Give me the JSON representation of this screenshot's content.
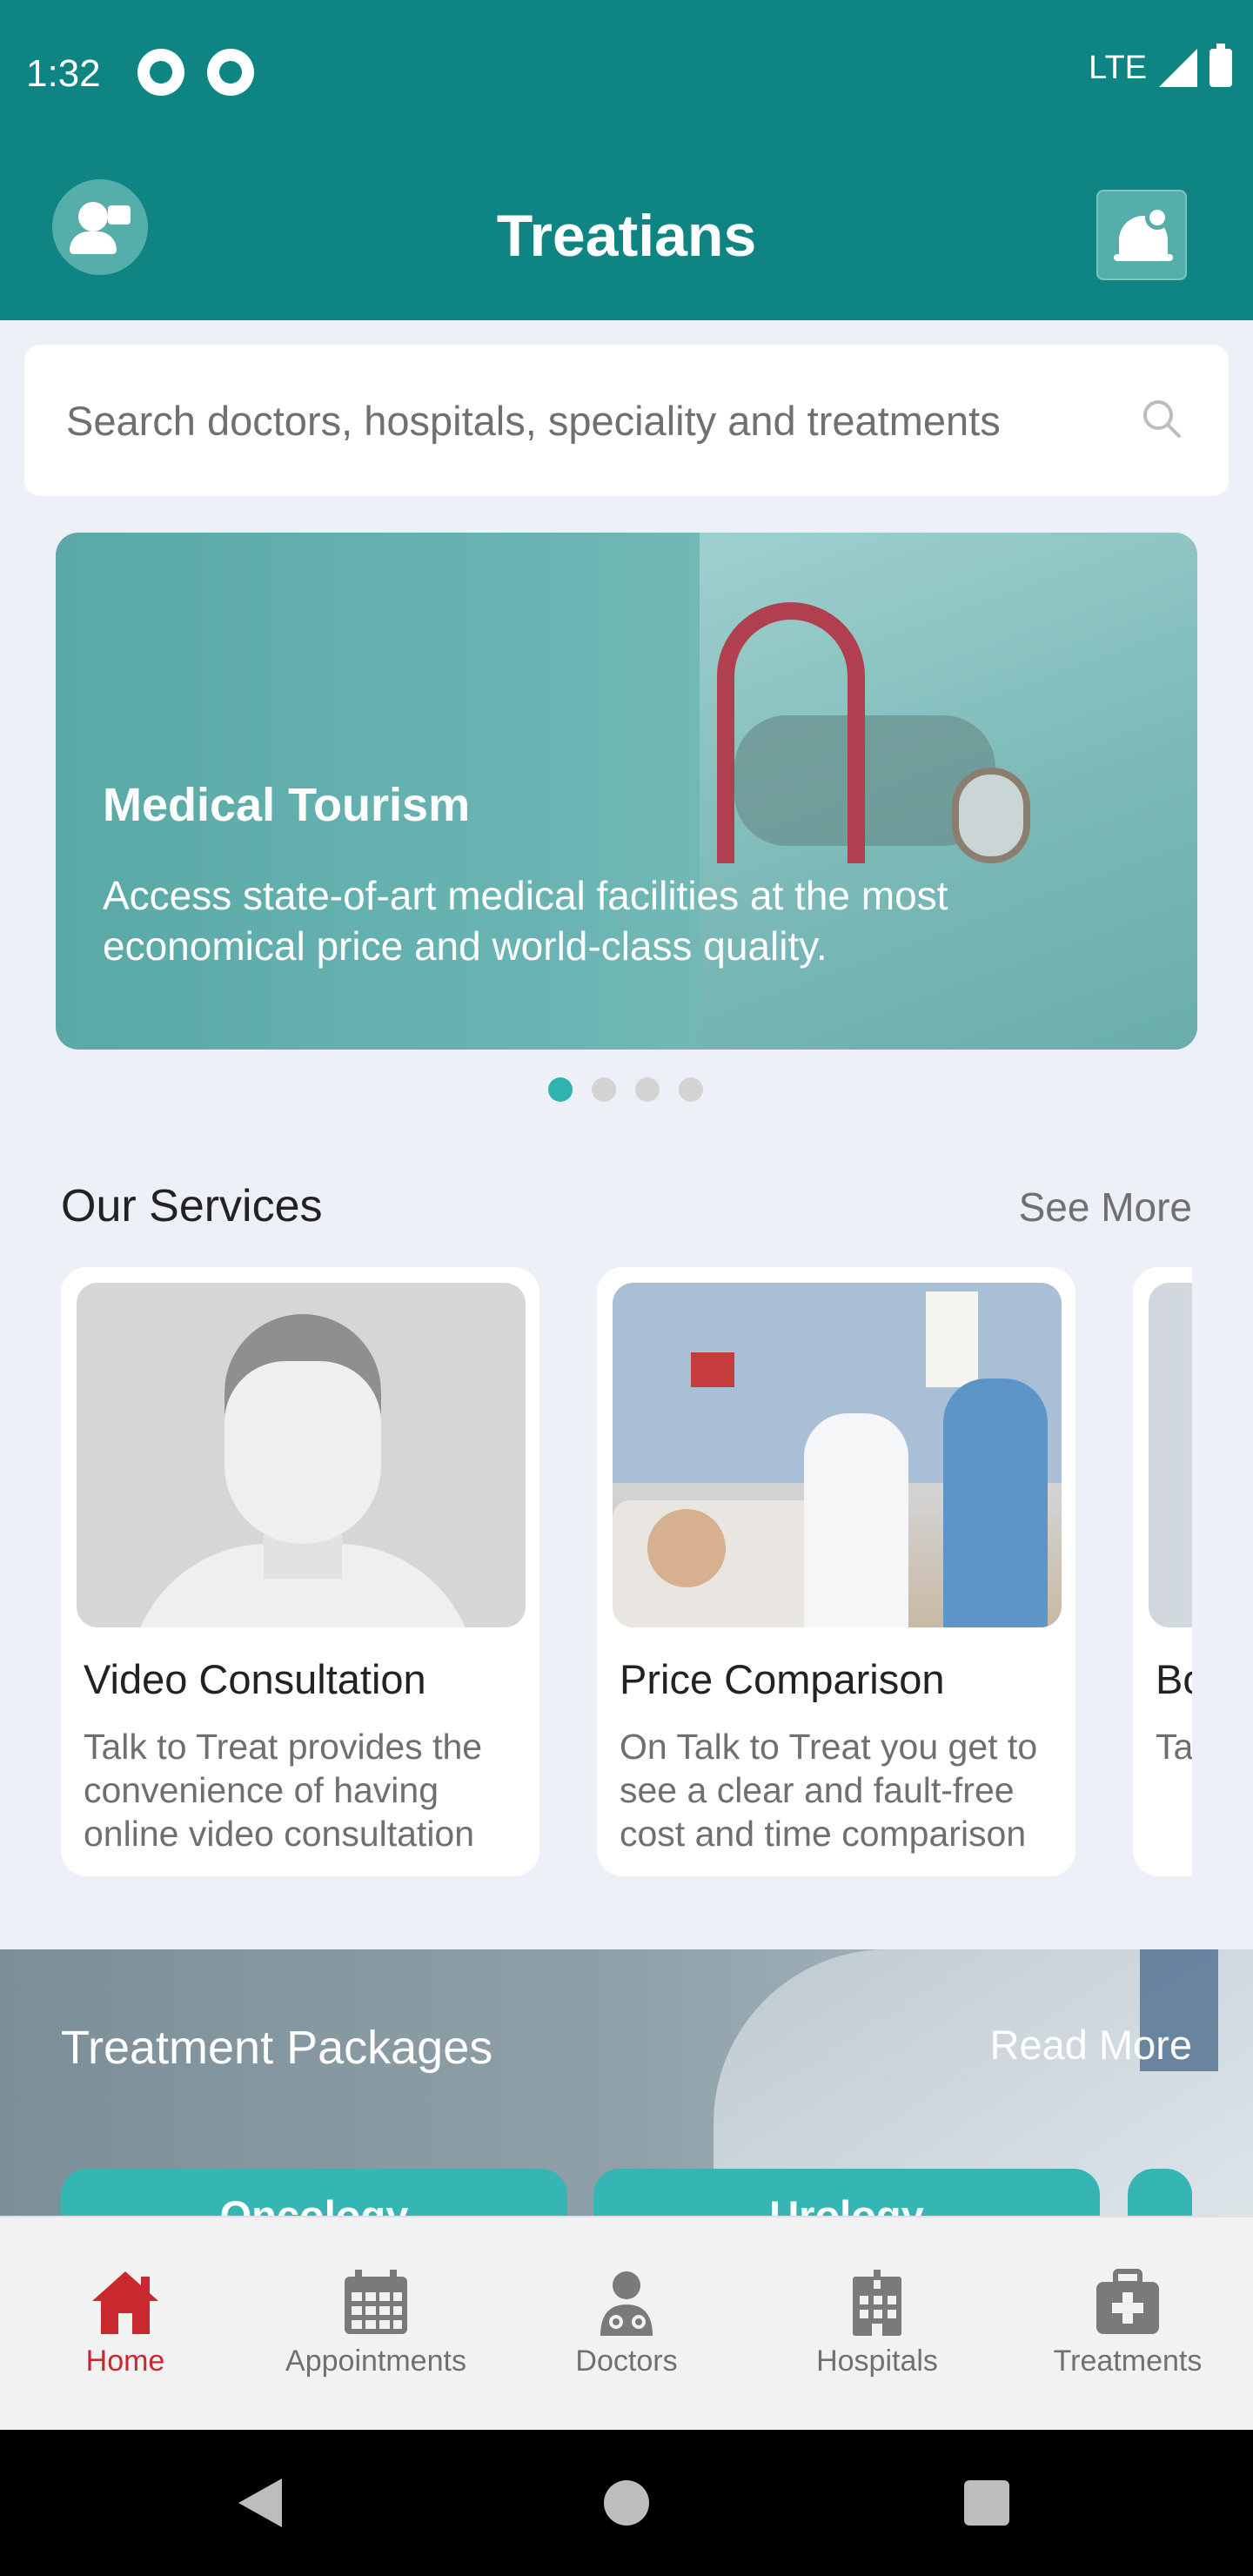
{
  "status_bar": {
    "time": "1:32",
    "network": "LTE"
  },
  "app_bar": {
    "title": "Treatians"
  },
  "search": {
    "placeholder": "Search doctors, hospitals, speciality and treatments"
  },
  "banner": {
    "title": "Medical Tourism",
    "text": "Access state-of-art medical facilities at the most economical price and world-class quality.",
    "dots_total": 4,
    "active_dot": 1
  },
  "services": {
    "title": "Our Services",
    "see_more": "See More",
    "cards": [
      {
        "title": "Video Consultation",
        "desc": "Talk to Treat provides the convenience of having online video consultation"
      },
      {
        "title": "Price Comparison",
        "desc": "On Talk to Treat you get to see a clear and fault-free cost and time comparison"
      },
      {
        "title": "Bo",
        "desc": "Ta to wo"
      }
    ]
  },
  "packages": {
    "title": "Treatment Packages",
    "read_more": "Read More",
    "items": [
      "Oncology",
      "Urology"
    ]
  },
  "bottom_nav": {
    "items": [
      {
        "label": "Home",
        "icon": "home-icon",
        "active": true
      },
      {
        "label": "Appointments",
        "icon": "calendar-icon",
        "active": false
      },
      {
        "label": "Doctors",
        "icon": "doctor-icon",
        "active": false
      },
      {
        "label": "Hospitals",
        "icon": "hospital-icon",
        "active": false
      },
      {
        "label": "Treatments",
        "icon": "medkit-icon",
        "active": false
      }
    ]
  },
  "colors": {
    "primary": "#0e8583",
    "accent": "#2fb3b0",
    "active_nav": "#c8282e",
    "background": "#eef0f8"
  }
}
